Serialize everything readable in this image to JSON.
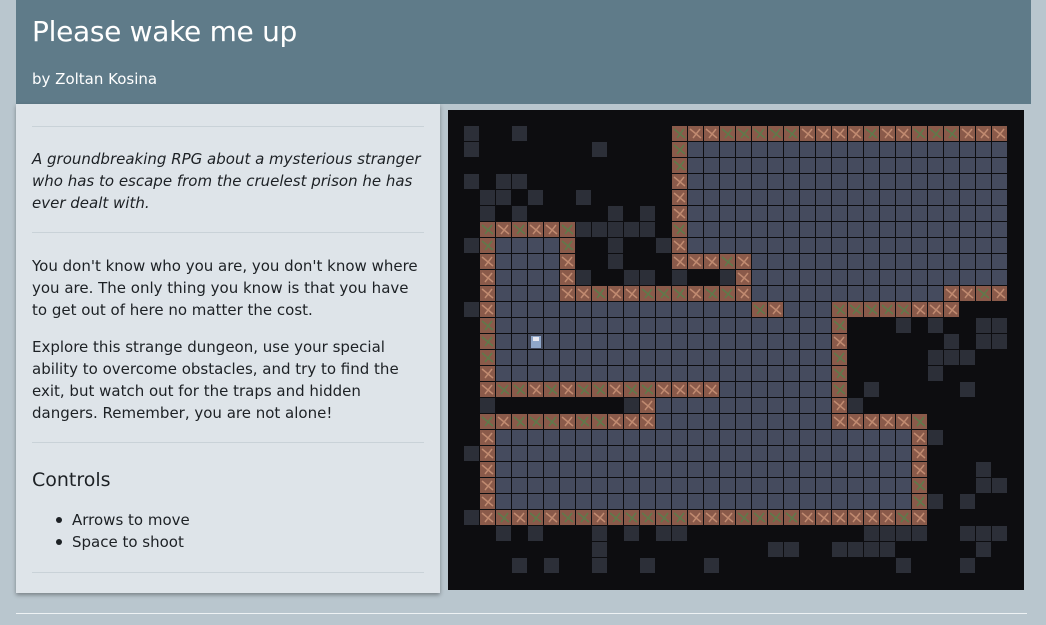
{
  "page": {
    "title": "Please wake me up",
    "author": "by Zoltan Kosina"
  },
  "sidebar": {
    "tagline": "A groundbreaking RPG about a mysterious stranger who has to escape from the cruelest prison he has ever dealt with.",
    "paragraphs": [
      "You don't know who you are, you don't know where you are. The only thing you know is that you have to get out of here no matter the cost.",
      "Explore this strange dungeon, use your special ability to overcome obstacles, and try to find the exit, but watch out for the traps and hidden dangers. Remember, you are not alone!"
    ],
    "controls_heading": "Controls",
    "controls": [
      "Arrows to move",
      "Space to shoot"
    ]
  },
  "colors": {
    "header_bg": "#5f7b89",
    "sidebar_bg": "#dee4e9",
    "page_bg": "#b9c6ce",
    "floor_tile": "#454b5e",
    "wall_tile": "#8a5a4a",
    "rubble_tile": "#2c2f38",
    "void": "#0d0d10"
  },
  "game": {
    "description_icon": "player-character-icon"
  }
}
